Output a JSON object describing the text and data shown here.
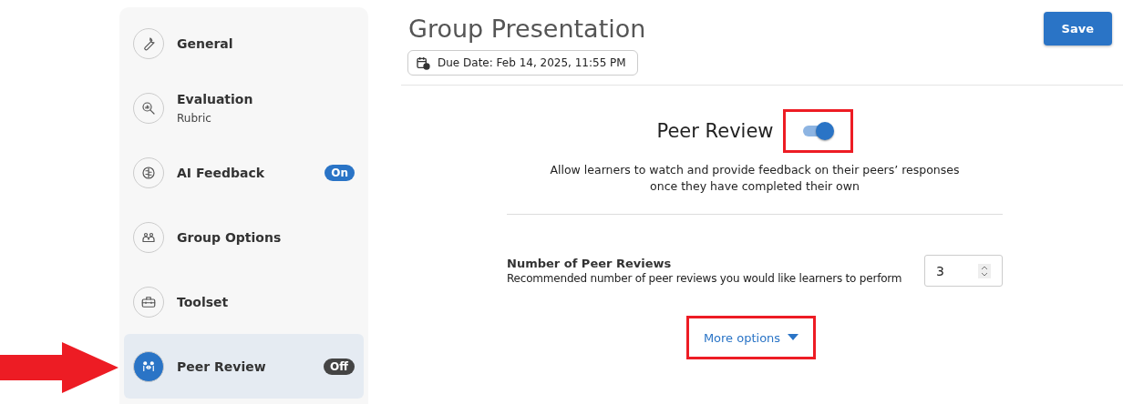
{
  "sidebar": {
    "items": [
      {
        "label": "General",
        "selected": false
      },
      {
        "label": "Evaluation",
        "sublabel": "Rubric",
        "selected": false
      },
      {
        "label": "AI Feedback",
        "badge": {
          "text": "On",
          "kind": "on"
        },
        "selected": false
      },
      {
        "label": "Group Options",
        "selected": false
      },
      {
        "label": "Toolset",
        "selected": false
      },
      {
        "label": "Peer Review",
        "badge": {
          "text": "Off",
          "kind": "off"
        },
        "selected": true,
        "pointed_at": true
      }
    ]
  },
  "header": {
    "title": "Group Presentation",
    "due_date": "Due Date: Feb 14, 2025, 11:55 PM",
    "save_button": "Save"
  },
  "peer_review": {
    "title": "Peer Review",
    "on": true,
    "toggle_highlighted": true,
    "description": "Allow learners to watch and provide feedback on their peers’ responses once they have completed their own",
    "number_label": "Number of Peer Reviews",
    "number_hint": "Recommended number of peer reviews you would like learners to perform",
    "number_value": "3",
    "more_options": {
      "label": "More options",
      "expanded": false,
      "highlighted": true
    }
  }
}
